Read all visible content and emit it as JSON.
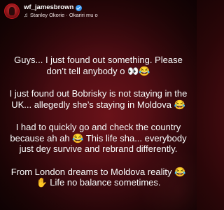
{
  "header": {
    "username": "wf_jamesbrown",
    "music_icon": "♫",
    "song": "Stanley Okorie · Okariri mu o"
  },
  "story": {
    "paragraphs": [
      "Guys... I just found out something. Please don’t tell anybody o 👀😂",
      "I just found out Bobrisky is not staying in the UK... allegedly she’s staying in Moldova 😂",
      "I had to quickly go and check the country because ah ah 😂 This life sha... everybody just dey survive and rebrand differently.",
      "From London dreams to Moldova reality 😂✋ Life no balance sometimes."
    ]
  },
  "colors": {
    "background": "#4a0c12",
    "verified": "#3897f0",
    "avatar_ring": "#c7161d"
  }
}
